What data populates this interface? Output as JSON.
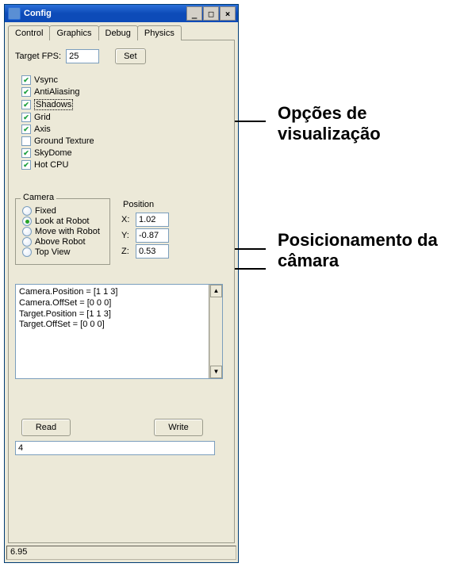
{
  "window": {
    "title": "Config"
  },
  "tabs": {
    "control": "Control",
    "graphics": "Graphics",
    "debug": "Debug",
    "physics": "Physics",
    "active": "graphics"
  },
  "fps": {
    "label": "Target FPS:",
    "value": "25",
    "set_label": "Set"
  },
  "options": [
    {
      "label": "Vsync",
      "checked": true
    },
    {
      "label": "AntiAliasing",
      "checked": true
    },
    {
      "label": "Shadows",
      "checked": true,
      "focused": true
    },
    {
      "label": "Grid",
      "checked": true
    },
    {
      "label": "Axis",
      "checked": true
    },
    {
      "label": "Ground Texture",
      "checked": false
    },
    {
      "label": "SkyDome",
      "checked": true
    },
    {
      "label": "Hot CPU",
      "checked": true
    }
  ],
  "camera": {
    "legend": "Camera",
    "modes": [
      {
        "label": "Fixed",
        "selected": false
      },
      {
        "label": "Look at Robot",
        "selected": true
      },
      {
        "label": "Move with Robot",
        "selected": false
      },
      {
        "label": "Above Robot",
        "selected": false
      },
      {
        "label": "Top View",
        "selected": false
      }
    ]
  },
  "position": {
    "title": "Position",
    "x_label": "X:",
    "x_value": "1.02",
    "y_label": "Y:",
    "y_value": "-0.87",
    "z_label": "Z:",
    "z_value": "0.53"
  },
  "log": {
    "lines": [
      "Camera.Position = [1 1 3]",
      "Camera.OffSet = [0 0 0]",
      "Target.Position = [1 1 3]",
      "Target.OffSet = [0 0 0]"
    ]
  },
  "rw": {
    "read": "Read",
    "write": "Write",
    "value": "4"
  },
  "status": {
    "value": "6.95"
  },
  "annotations": {
    "viz": "Opções de visualização",
    "cam": "Posicionamento da câmara"
  }
}
